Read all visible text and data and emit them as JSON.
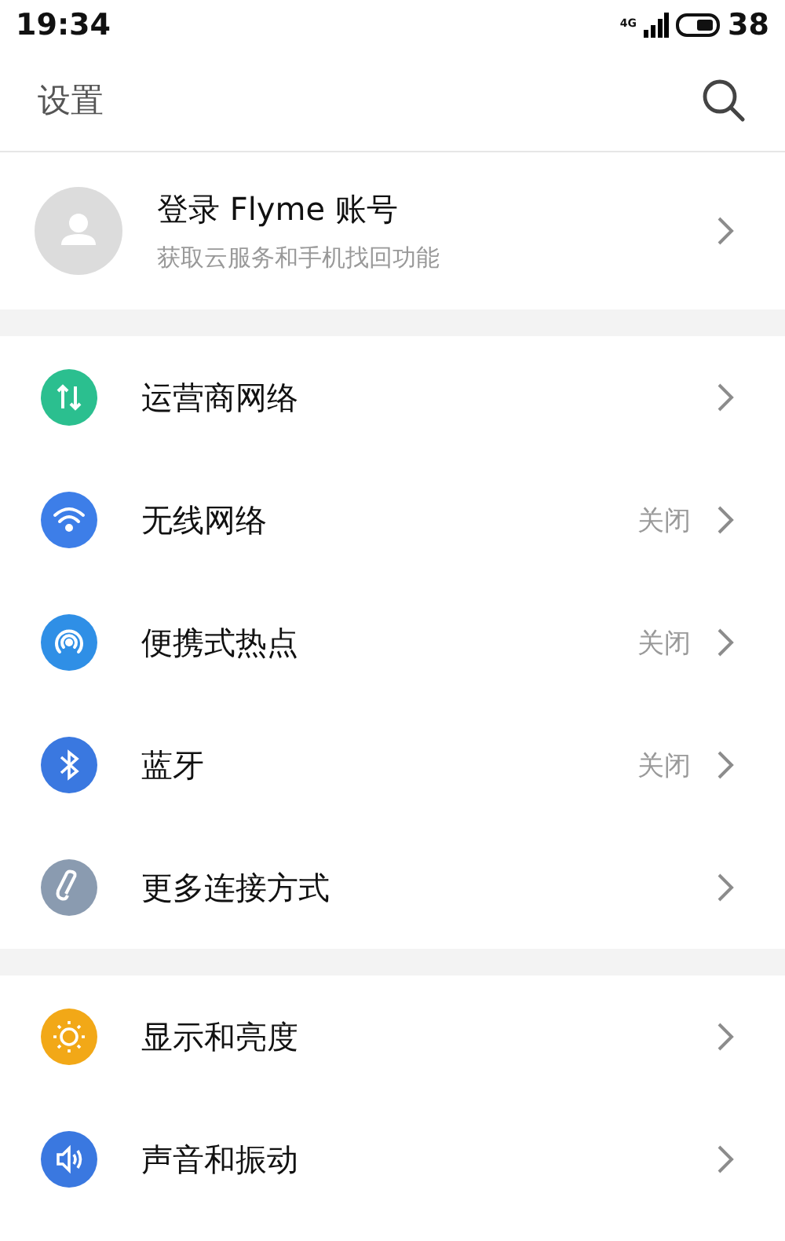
{
  "status_bar": {
    "time": "19:34",
    "network": "4G",
    "battery": "38"
  },
  "header": {
    "title": "设置"
  },
  "account": {
    "title": "登录 Flyme 账号",
    "subtitle": "获取云服务和手机找回功能"
  },
  "sections": [
    {
      "items": [
        {
          "label": "运营商网络",
          "color": "#2bbf8f"
        },
        {
          "label": "无线网络",
          "value": "关闭",
          "color": "#3d7ee8"
        },
        {
          "label": "便携式热点",
          "value": "关闭",
          "color": "#2f8fe6"
        },
        {
          "label": "蓝牙",
          "value": "关闭",
          "color": "#3a78e0"
        },
        {
          "label": "更多连接方式",
          "color": "#8a9bb0"
        }
      ]
    },
    {
      "items": [
        {
          "label": "显示和亮度",
          "color": "#f2a817"
        },
        {
          "label": "声音和振动",
          "color": "#3a78e0"
        }
      ]
    }
  ]
}
